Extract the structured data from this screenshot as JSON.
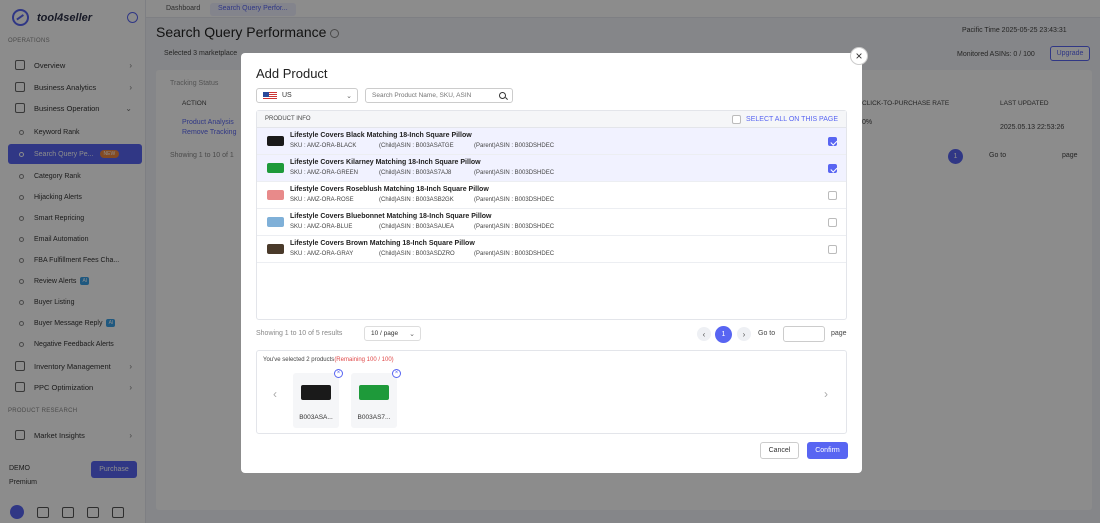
{
  "sidebar": {
    "brand": "tool4seller",
    "section_operations": "OPERATIONS",
    "section_research": "PRODUCT RESEARCH",
    "items": [
      {
        "label": "Overview"
      },
      {
        "label": "Business Analytics"
      },
      {
        "label": "Business Operation"
      }
    ],
    "sub_items": [
      {
        "label": "Keyword Rank"
      },
      {
        "label": "Search Query Pe...",
        "badge": "NEW"
      },
      {
        "label": "Category Rank"
      },
      {
        "label": "Hijacking Alerts"
      },
      {
        "label": "Smart Repricing"
      },
      {
        "label": "Email Automation"
      },
      {
        "label": "FBA Fulfillment Fees Cha..."
      },
      {
        "label": "Review Alerts",
        "badge": "AI"
      },
      {
        "label": "Buyer Listing"
      },
      {
        "label": "Buyer Message Reply",
        "badge": "AI"
      },
      {
        "label": "Negative Feedback Alerts"
      }
    ],
    "more_items": [
      {
        "label": "Inventory Management"
      },
      {
        "label": "PPC Optimization"
      }
    ],
    "research_items": [
      {
        "label": "Market Insights"
      }
    ],
    "plan_name": "DEMO",
    "plan_tier": "Premium",
    "purchase_label": "Purchase"
  },
  "topbar": {
    "tabs": [
      "Dashboard",
      "Search Query Perfor..."
    ]
  },
  "page": {
    "title": "Search Query Performance",
    "pacific_time": "Pacific Time   2025-05-25 23:43:31",
    "selected_markets": "Selected 3 marketplace",
    "monitored": "Monitored ASINs: 0 / 100",
    "upgrade_label": "Upgrade",
    "tracking_status": "Tracking Status",
    "header_action": "ACTION",
    "header_ctp": "CLICK-TO-PURCHASE RATE",
    "header_updated": "LAST UPDATED",
    "link_analysis": "Product Analysis",
    "link_remove": "Remove Tracking",
    "bg_pct": "0%",
    "bg_updated": "2025.05.13 22:53:26",
    "bg_showing": "Showing 1 to 10 of 1",
    "bg_page": "1",
    "bg_goto": "Go to",
    "bg_page_label": "page"
  },
  "modal": {
    "title": "Add Product",
    "country": "US",
    "search_placeholder": "Search Product Name, SKU, ASIN",
    "col_product_info": "PRODUCT INFO",
    "select_all": "SELECT ALL ON THIS PAGE",
    "products": [
      {
        "name": "Lifestyle Covers Black Matching 18-Inch Square Pillow",
        "sku": "SKU : AMZ-ORA-BLACK",
        "child": "(Child)ASIN : B003ASATGE",
        "parent": "(Parent)ASIN : B003DSHDEC",
        "checked": true,
        "color": "#1a1a1a"
      },
      {
        "name": "Lifestyle Covers Kilarney Matching 18-Inch Square Pillow",
        "sku": "SKU : AMZ-ORA-GREEN",
        "child": "(Child)ASIN : B003AS7AJ8",
        "parent": "(Parent)ASIN : B003DSHDEC",
        "checked": true,
        "color": "#1e9a3a"
      },
      {
        "name": "Lifestyle Covers Roseblush Matching 18-Inch Square Pillow",
        "sku": "SKU : AMZ-ORA-ROSE",
        "child": "(Child)ASIN : B003ASB2GK",
        "parent": "(Parent)ASIN : B003DSHDEC",
        "checked": false,
        "color": "#e88a8a"
      },
      {
        "name": "Lifestyle Covers Bluebonnet Matching 18-Inch Square Pillow",
        "sku": "SKU : AMZ-ORA-BLUE",
        "child": "(Child)ASIN : B003ASAUEA",
        "parent": "(Parent)ASIN : B003DSHDEC",
        "checked": false,
        "color": "#7fb0d8"
      },
      {
        "name": "Lifestyle Covers Brown Matching 18-Inch Square Pillow",
        "sku": "SKU : AMZ-ORA-GRAY",
        "child": "(Child)ASIN : B003ASDZRO",
        "parent": "(Parent)ASIN : B003DSHDEC",
        "checked": false,
        "color": "#4a3a2a"
      }
    ],
    "showing": "Showing 1 to 10 of 5 results",
    "per_page": "10 / page",
    "page_current": "1",
    "goto_label": "Go to",
    "page_label": "page",
    "selected_prefix": "You've selected 2 products",
    "remaining": "(Remaining 100 / 100)",
    "selected_cards": [
      {
        "label": "B003ASA...",
        "color": "#1a1a1a"
      },
      {
        "label": "B003AS7...",
        "color": "#1e9a3a"
      }
    ],
    "cancel_label": "Cancel",
    "confirm_label": "Confirm"
  }
}
